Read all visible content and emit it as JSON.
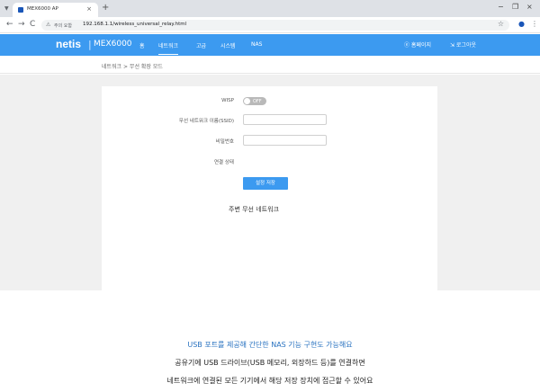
{
  "browser": {
    "tab_title": "MEX6000 AP",
    "tab_close": "×",
    "new_tab": "+",
    "security": "주의 요함",
    "url": "192.168.1.1/wireless_universal_relay.html",
    "win_min": "−",
    "win_max": "❐",
    "win_close": "×",
    "back": "←",
    "forward": "→",
    "reload": "C",
    "warn": "⚠",
    "star": "☆",
    "profile": "●",
    "menu": "⋮",
    "tab_dd": "▼"
  },
  "header": {
    "logo": "netis",
    "sep": "|",
    "model": "MEX6000",
    "nav": [
      "홈",
      "네트워크",
      "고급",
      "시스템",
      "NAS"
    ],
    "active_index": 1,
    "language": "ⓔ 홈페이지",
    "logout": "⇲ 로그아웃"
  },
  "breadcrumb": "네트워크 > 무선 확장 모드",
  "form": {
    "wisp_label": "WISP",
    "wisp_state": "OFF",
    "ssid_label": "무선 네트워크 이름(SSID)",
    "ssid_value": "",
    "password_label": "비밀번호",
    "password_value": "",
    "status_label": "연결 상태",
    "status_value": "",
    "save_button": "설정 저장",
    "nearby_title": "주변 무선 네트워크"
  },
  "captions": [
    "USB 포트를 제공해 간단한 NAS 기능 구현도 가능해요",
    "공유기에 USB 드라이브(USB 메모리, 외장하드 등)를 연결하면",
    "네트워크에 연결된 모든 기기에서 해당 저장 장치에 접근할 수 있어요"
  ],
  "colors": {
    "header_bg": "#3c9af0",
    "caption_highlight": "#2a73c0",
    "content_bg": "#f0f0f0"
  }
}
